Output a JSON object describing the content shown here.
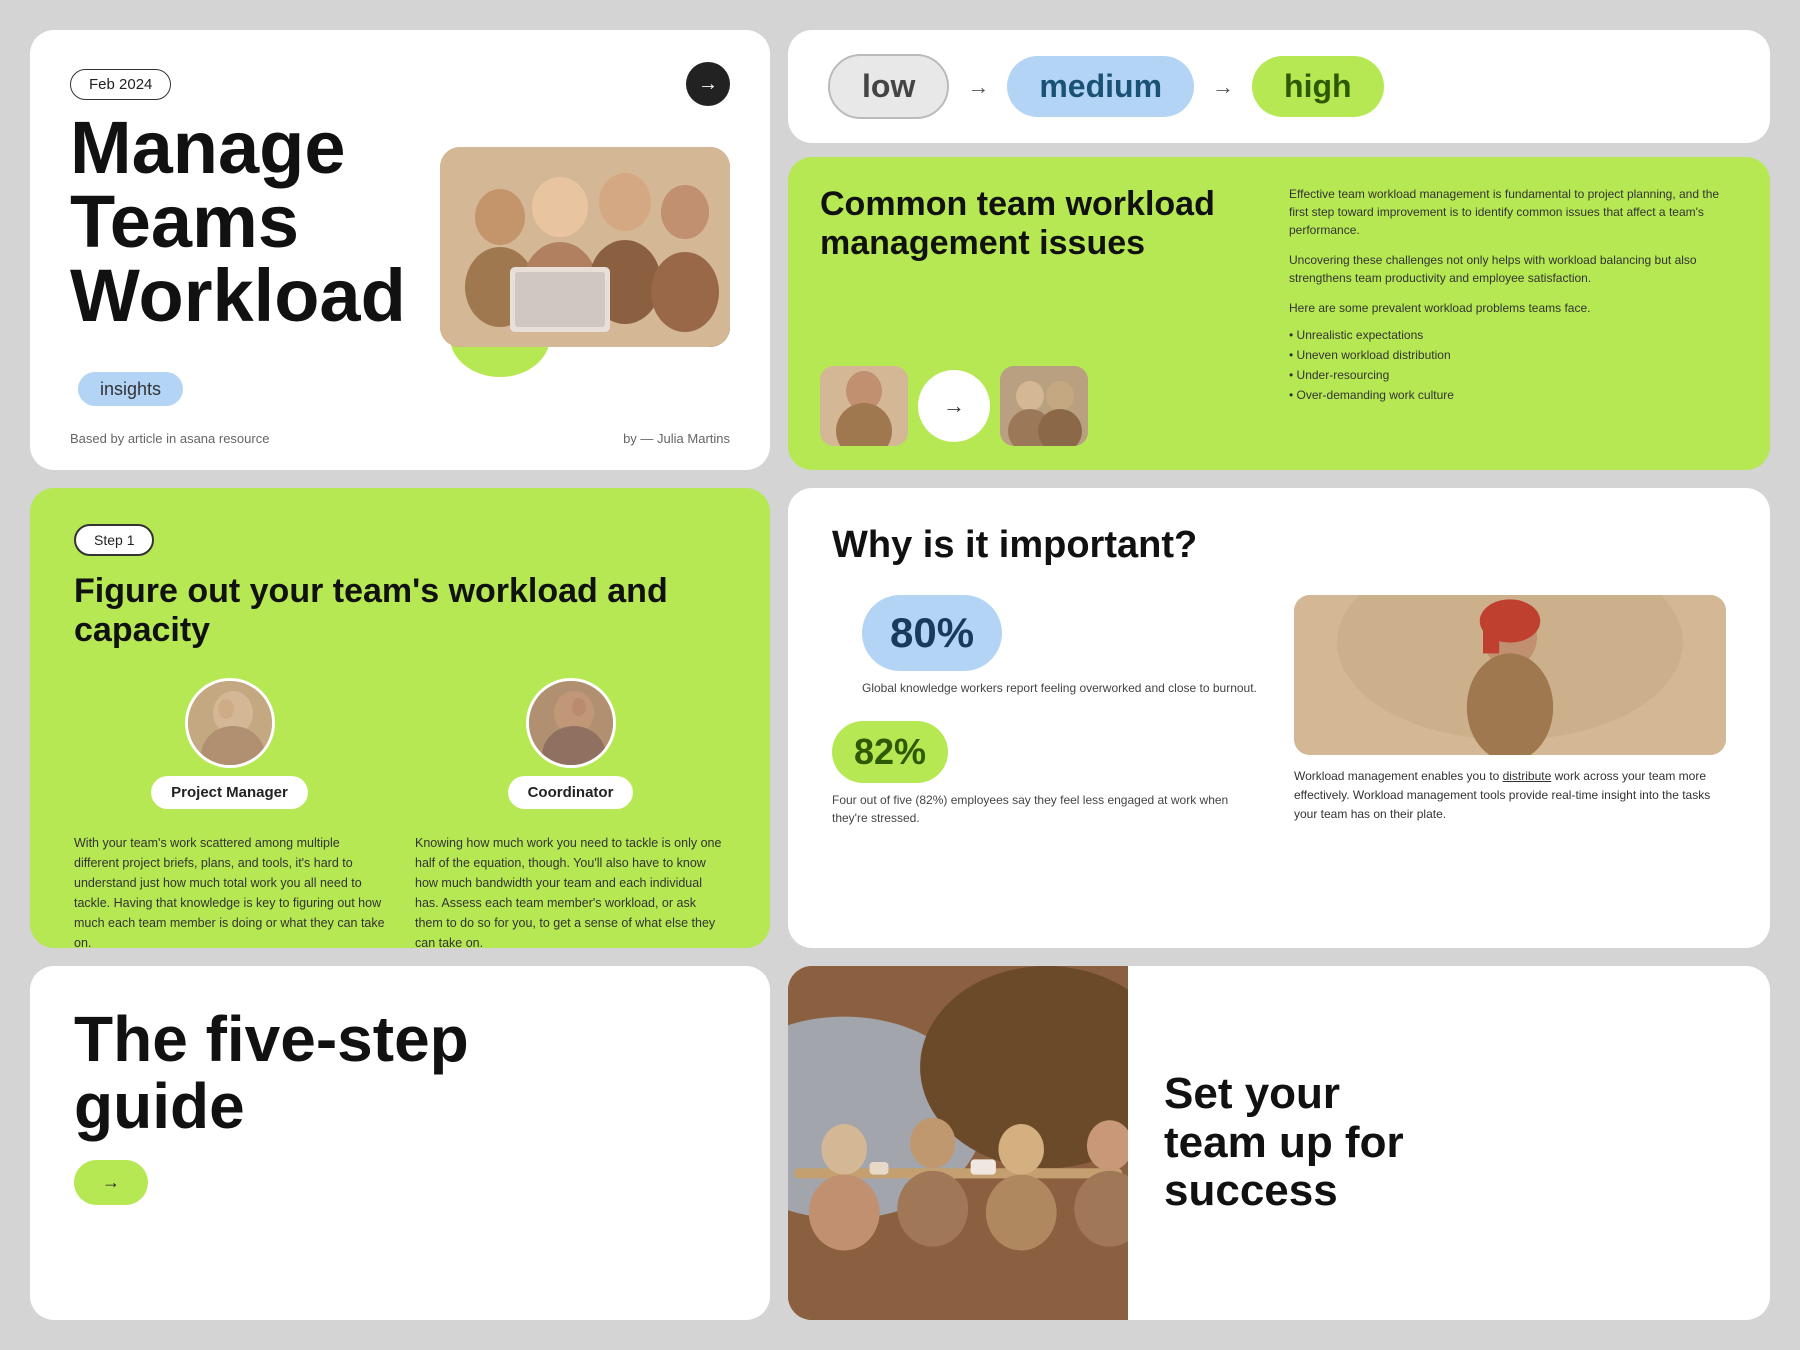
{
  "hero": {
    "date": "Feb 2024",
    "title_line1": "Manage",
    "title_line2": "Teams",
    "title_line3": "Workload",
    "badge": "insights",
    "source": "Based by article in asana resource",
    "author": "by — Julia Martins"
  },
  "levels": {
    "low_label": "low",
    "medium_label": "medium",
    "high_label": "high"
  },
  "issues": {
    "title": "Common team workload management issues",
    "description1": "Effective team workload management is fundamental to project planning, and the first step toward improvement is to identify common issues that affect a team's performance.",
    "description2": "Uncovering these challenges not only helps with workload balancing but also strengthens team productivity and employee satisfaction.",
    "problems_intro": "Here are some prevalent workload problems teams face.",
    "problems": [
      "Unrealistic expectations",
      "Uneven workload distribution",
      "Under-resourcing",
      "Over-demanding work culture"
    ]
  },
  "step1": {
    "badge": "Step 1",
    "title": "Figure out your team's workload and capacity",
    "person1_name": "Project Manager",
    "person2_name": "Coordinator",
    "person1_desc": "With your team's work scattered among multiple different project briefs, plans, and tools, it's hard to understand just how much total work you all need to tackle. Having that knowledge is key to figuring out how much each team member is doing or what they can take on.",
    "person2_desc": "Knowing how much work you need to tackle is only one half of the equation, though. You'll also have to know how much bandwidth your team and each individual has. Assess each team member's workload, or ask them to do so for you, to get a sense of what else they can take on."
  },
  "why": {
    "title": "Why is it important?",
    "stat1": "80%",
    "stat1_label": "Global knowledge workers report feeling overworked and close to burnout.",
    "stat2": "82%",
    "stat2_label": "Four out of five (82%) employees say they feel less engaged at work when they're stressed.",
    "description": "Workload management enables you to distribute work across your team more effectively. Workload management tools provide real-time insight into the tasks your team has on their plate."
  },
  "fivestep": {
    "title_line1": "The five-step",
    "title_line2": "guide",
    "button_label": "→"
  },
  "success": {
    "title_line1": "Set your",
    "title_line2": "team up for",
    "title_line3": "success"
  }
}
